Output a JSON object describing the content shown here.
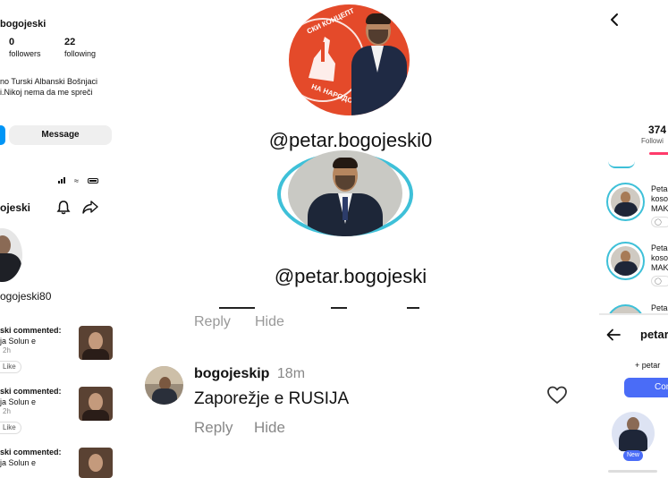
{
  "left_profile": {
    "name_fragment": "bogojeski",
    "followers_count": "0",
    "followers_label": "followers",
    "following_count": "22",
    "following_label": "following",
    "bio_line1": "no Turski Albanski Bošnjaci",
    "bio_line2": "i.Nikoj nema da me spreči",
    "message_button": "Message"
  },
  "left_activity": {
    "username_fragment": "ojeski",
    "handle_fragment": "ogojeski80",
    "notifications": [
      {
        "line1": "ski commented:",
        "line2": "ja Solun e",
        "time": "2h",
        "like": "Like"
      },
      {
        "line1": "ski commented:",
        "line2": "ja Solun e",
        "time": "2h",
        "like": "Like"
      },
      {
        "line1": "ski commented:",
        "line2": "ja Solun e"
      }
    ]
  },
  "middle": {
    "handle_top": "@petar.bogojeski0",
    "handle_bottom": "@petar.bogojeski",
    "banner_text_top": "СКИ КОНЦЕПТ",
    "banner_text_bottom": "НА НАРОДОТ",
    "reply_top": "Reply",
    "hide_top": "Hide",
    "comment": {
      "username": "bogojeskip",
      "time": "18m",
      "text": "Zaporežje e RUSIJA",
      "reply": "Reply",
      "hide": "Hide"
    }
  },
  "right_panel": {
    "count": "374",
    "count_label": "Followi",
    "list": [
      {
        "line1": "Peta",
        "line2": "koso",
        "line3": "MAK"
      },
      {
        "line1": "Peta",
        "line2": "koso",
        "line3": "MAK"
      },
      {
        "line1": "Peta"
      }
    ],
    "header_title": "petar",
    "follow_hint": "+ petar",
    "connect_label": "Con",
    "new_badge": "New",
    "accent_color": "#4a6cf7",
    "pink_color": "#ff3b6b"
  }
}
